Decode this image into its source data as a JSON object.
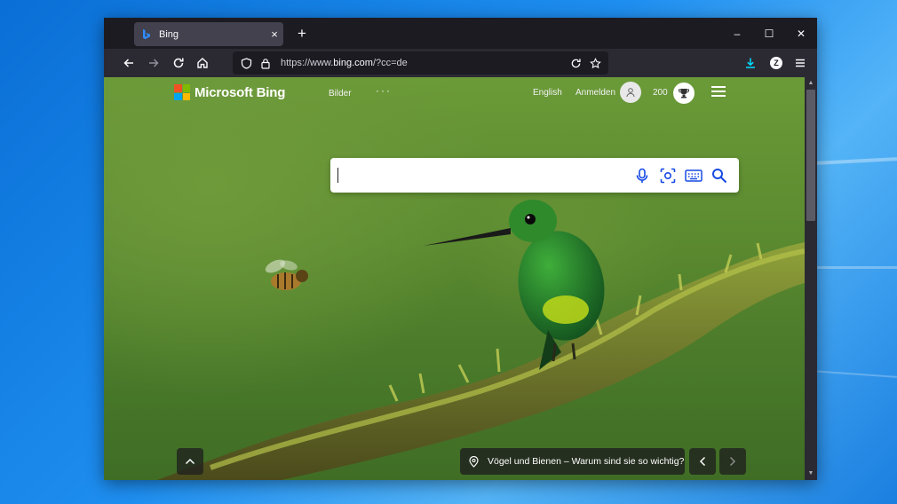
{
  "browser": {
    "tab": {
      "title": "Bing",
      "close_glyph": "×"
    },
    "new_tab_glyph": "+",
    "window_controls": {
      "minimize": "–",
      "maximize": "☐",
      "close": "✕"
    },
    "url": {
      "scheme": "https://www.",
      "host": "bing.com",
      "path": "/?cc=de"
    },
    "profile_initial": "Z"
  },
  "bing": {
    "logo_text": "Microsoft Bing",
    "nav_images": "Bilder",
    "more_dots": "···",
    "language": "English",
    "sign_in": "Anmelden",
    "rewards_points": "200",
    "search": {
      "value": "",
      "placeholder": ""
    },
    "caption": "Vögel und Bienen – Warum sind sie so wichtig?"
  },
  "colors": {
    "ms_red": "#f25022",
    "ms_green": "#7fba00",
    "ms_blue": "#00a4ef",
    "ms_yellow": "#ffb900",
    "bing_blue": "#174ae4",
    "download_blue": "#00ddff"
  }
}
